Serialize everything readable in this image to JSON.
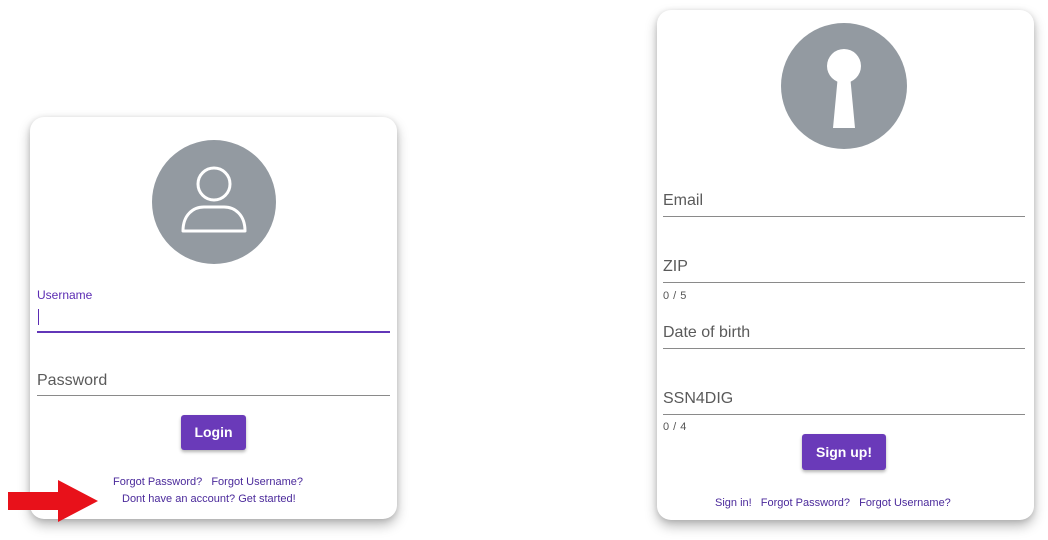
{
  "login": {
    "username_label": "Username",
    "username_value": "",
    "password_label": "Password",
    "login_button": "Login",
    "forgot_password": "Forgot Password?",
    "forgot_username": "Forgot Username?",
    "get_started": "Dont have an account? Get started!",
    "avatar_icon": "user-icon"
  },
  "signup": {
    "avatar_icon": "keyhole-icon",
    "email_label": "Email",
    "zip_label": "ZIP",
    "zip_counter": "0 / 5",
    "dob_label": "Date of birth",
    "ssn_label": "SSN4DIG",
    "ssn_counter": "0 / 4",
    "signup_button": "Sign up!",
    "sign_in": "Sign in!",
    "forgot_password": "Forgot Password?",
    "forgot_username": "Forgot Username?"
  },
  "annotation": {
    "arrow_color": "#e8111a",
    "arrow_icon": "red-arrow-icon"
  },
  "colors": {
    "accent": "#6a3ab9",
    "link": "#4b2a9b",
    "avatar_bg": "#939aa1"
  }
}
